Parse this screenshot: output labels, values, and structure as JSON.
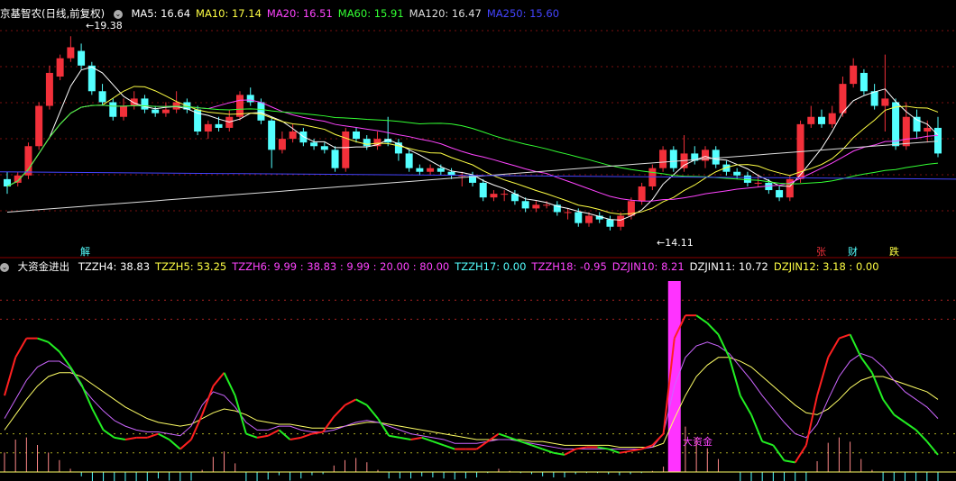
{
  "colors": {
    "up": "#f2303a",
    "down": "#54ffff",
    "ma5": "#ffffff",
    "ma10": "#ffff44",
    "ma20": "#ff44ff",
    "ma60": "#33ff33",
    "ma120": "#dddddd",
    "ma250": "#4444ff",
    "grid": "#7a1010"
  },
  "main_panel": {
    "title": "京基智农(日线,前复权)",
    "ma": [
      {
        "label": "MA5: 16.64",
        "color": "#ffffff"
      },
      {
        "label": "MA10: 17.14",
        "color": "#ffff44"
      },
      {
        "label": "MA20: 16.51",
        "color": "#ff44ff"
      },
      {
        "label": "MA60: 15.91",
        "color": "#33ff33"
      },
      {
        "label": "MA120: 16.47",
        "color": "#dddddd"
      },
      {
        "label": "MA250: 15.60",
        "color": "#4444ff"
      }
    ],
    "high_label": "19.38",
    "low_label": "14.11",
    "markers": [
      {
        "text": "解",
        "color": "#54ffff"
      },
      {
        "text": "张",
        "color": "#f2303a"
      },
      {
        "text": "财",
        "color": "#54ffff"
      },
      {
        "text": "跌",
        "color": "#ffff44"
      }
    ]
  },
  "indicator_panel": {
    "title": "大资金进出",
    "values": [
      {
        "label": "TZZH4: 38.83",
        "color": "#ffffff"
      },
      {
        "label": "TZZH5: 53.25",
        "color": "#ffff44"
      },
      {
        "label": "TZZH6: 9.99 : 38.83 : 9.99 : 20.00 : 80.00",
        "color": "#ff44ff"
      },
      {
        "label": "TZZH17: 0.00",
        "color": "#54ffff"
      },
      {
        "label": "TZZH18: -0.95",
        "color": "#ff44ff"
      },
      {
        "label": "DZJIN10: 8.21",
        "color": "#ff44ff"
      },
      {
        "label": "DZJIN11: 10.72",
        "color": "#ffffff"
      },
      {
        "label": "DZJIN12: 3.18 : 0.00",
        "color": "#ffff44"
      }
    ],
    "big_fund_label": "大资金"
  },
  "chart_data": {
    "type": "candlestick",
    "price_range": [
      13.8,
      19.8
    ],
    "candles": [
      [
        15.5,
        15.3,
        15.7,
        15.1
      ],
      [
        15.4,
        15.6,
        15.7,
        15.3
      ],
      [
        15.6,
        16.4,
        16.5,
        15.5
      ],
      [
        16.4,
        17.5,
        17.6,
        16.3
      ],
      [
        17.5,
        18.4,
        18.6,
        17.4
      ],
      [
        18.3,
        18.8,
        18.9,
        18.2
      ],
      [
        18.8,
        19.1,
        19.4,
        18.7
      ],
      [
        19.0,
        18.6,
        19.2,
        18.5
      ],
      [
        18.6,
        17.9,
        18.7,
        17.8
      ],
      [
        17.9,
        17.6,
        18.1,
        17.5
      ],
      [
        17.6,
        17.2,
        17.7,
        17.1
      ],
      [
        17.2,
        17.5,
        17.7,
        17.1
      ],
      [
        17.5,
        17.7,
        17.9,
        17.4
      ],
      [
        17.7,
        17.4,
        17.8,
        17.3
      ],
      [
        17.4,
        17.3,
        17.5,
        17.2
      ],
      [
        17.3,
        17.4,
        17.6,
        17.2
      ],
      [
        17.4,
        17.6,
        17.9,
        17.3
      ],
      [
        17.6,
        17.4,
        17.7,
        17.3
      ],
      [
        17.4,
        16.8,
        17.5,
        16.7
      ],
      [
        16.8,
        17.0,
        17.1,
        16.6
      ],
      [
        17.0,
        16.9,
        17.2,
        16.8
      ],
      [
        16.9,
        17.2,
        17.4,
        16.8
      ],
      [
        17.2,
        17.8,
        17.9,
        17.1
      ],
      [
        17.8,
        17.6,
        18.0,
        17.5
      ],
      [
        17.6,
        17.1,
        17.7,
        17.0
      ],
      [
        17.1,
        16.3,
        17.2,
        15.8
      ],
      [
        16.3,
        16.6,
        16.8,
        16.2
      ],
      [
        16.6,
        16.8,
        17.0,
        16.5
      ],
      [
        16.8,
        16.5,
        16.9,
        16.4
      ],
      [
        16.5,
        16.4,
        16.6,
        16.3
      ],
      [
        16.4,
        16.3,
        16.5,
        16.2
      ],
      [
        16.3,
        15.8,
        16.4,
        15.7
      ],
      [
        15.8,
        16.8,
        16.9,
        15.7
      ],
      [
        16.8,
        16.6,
        16.9,
        16.5
      ],
      [
        16.6,
        16.4,
        16.7,
        16.3
      ],
      [
        16.4,
        16.6,
        16.8,
        16.3
      ],
      [
        16.6,
        16.5,
        17.2,
        16.4
      ],
      [
        16.5,
        16.2,
        16.6,
        16.0
      ],
      [
        16.2,
        15.8,
        16.3,
        15.7
      ],
      [
        15.8,
        15.7,
        15.9,
        15.6
      ],
      [
        15.7,
        15.8,
        15.9,
        15.6
      ],
      [
        15.8,
        15.7,
        15.9,
        15.6
      ],
      [
        15.7,
        15.6,
        15.8,
        15.5
      ],
      [
        15.6,
        15.6,
        15.7,
        15.3
      ],
      [
        15.6,
        15.4,
        15.7,
        15.3
      ],
      [
        15.4,
        15.0,
        15.5,
        14.9
      ],
      [
        15.0,
        15.1,
        15.2,
        14.9
      ],
      [
        15.1,
        15.1,
        15.2,
        14.9
      ],
      [
        15.1,
        14.9,
        15.2,
        14.8
      ],
      [
        14.9,
        14.7,
        15.0,
        14.6
      ],
      [
        14.7,
        14.8,
        14.9,
        14.6
      ],
      [
        14.8,
        14.8,
        14.9,
        14.7
      ],
      [
        14.8,
        14.6,
        14.9,
        14.5
      ],
      [
        14.6,
        14.6,
        14.7,
        14.4
      ],
      [
        14.6,
        14.3,
        14.7,
        14.2
      ],
      [
        14.3,
        14.5,
        14.6,
        14.2
      ],
      [
        14.5,
        14.4,
        14.6,
        14.3
      ],
      [
        14.4,
        14.2,
        14.5,
        14.1
      ],
      [
        14.2,
        14.5,
        14.6,
        14.1
      ],
      [
        14.5,
        14.9,
        15.0,
        14.4
      ],
      [
        14.9,
        15.3,
        15.4,
        14.8
      ],
      [
        15.3,
        15.8,
        15.9,
        15.2
      ],
      [
        15.8,
        16.3,
        16.4,
        15.7
      ],
      [
        16.3,
        15.8,
        16.4,
        15.7
      ],
      [
        15.8,
        16.2,
        16.7,
        15.7
      ],
      [
        16.2,
        16.0,
        16.4,
        15.9
      ],
      [
        16.0,
        16.3,
        16.4,
        15.8
      ],
      [
        16.3,
        15.9,
        16.4,
        15.8
      ],
      [
        15.9,
        15.7,
        16.0,
        15.6
      ],
      [
        15.7,
        15.6,
        15.8,
        15.5
      ],
      [
        15.6,
        15.4,
        15.7,
        15.3
      ],
      [
        15.4,
        15.4,
        15.6,
        15.3
      ],
      [
        15.4,
        15.2,
        15.5,
        15.1
      ],
      [
        15.2,
        15.0,
        15.3,
        14.9
      ],
      [
        15.0,
        15.5,
        15.6,
        14.9
      ],
      [
        15.5,
        17.0,
        17.1,
        15.4
      ],
      [
        17.0,
        17.2,
        17.5,
        16.9
      ],
      [
        17.2,
        17.0,
        17.4,
        16.9
      ],
      [
        17.0,
        17.3,
        17.5,
        16.9
      ],
      [
        17.3,
        18.1,
        18.3,
        17.2
      ],
      [
        18.1,
        18.6,
        18.8,
        18.0
      ],
      [
        18.4,
        17.9,
        18.5,
        17.8
      ],
      [
        17.9,
        17.5,
        18.1,
        17.4
      ],
      [
        17.5,
        17.7,
        18.9,
        16.8
      ],
      [
        17.6,
        16.4,
        17.7,
        16.3
      ],
      [
        16.4,
        17.2,
        17.6,
        16.3
      ],
      [
        17.2,
        16.8,
        17.4,
        16.6
      ],
      [
        16.8,
        16.9,
        17.1,
        16.5
      ],
      [
        16.9,
        16.2,
        17.2,
        16.1
      ]
    ],
    "ma_values": {
      "MA5": 16.64,
      "MA10": 17.14,
      "MA20": 16.51,
      "MA60": 15.91,
      "MA120": 16.47,
      "MA250": 15.6
    },
    "indicator": {
      "red_green_line": [
        40,
        60,
        70,
        70,
        68,
        63,
        55,
        46,
        33,
        22,
        18,
        17,
        18,
        18,
        20,
        17,
        12,
        17,
        30,
        45,
        52,
        40,
        20,
        18,
        19,
        22,
        17,
        18,
        20,
        21,
        29,
        35,
        38,
        35,
        28,
        19,
        18,
        17,
        18,
        16,
        14,
        12,
        12,
        12,
        16,
        20,
        18,
        16,
        14,
        12,
        10,
        9,
        12,
        13,
        13,
        12,
        10,
        11,
        12,
        14,
        20,
        70,
        82,
        82,
        78,
        72,
        60,
        40,
        30,
        16,
        14,
        6,
        5,
        14,
        40,
        60,
        70,
        72,
        60,
        52,
        38,
        30,
        26,
        22,
        16,
        9
      ],
      "magenta_line": [
        28,
        38,
        48,
        55,
        58,
        58,
        54,
        45,
        38,
        32,
        27,
        24,
        22,
        21,
        21,
        20,
        19,
        24,
        35,
        42,
        40,
        34,
        26,
        22,
        22,
        24,
        24,
        22,
        21,
        21,
        22,
        24,
        26,
        27,
        26,
        24,
        22,
        20,
        19,
        18,
        17,
        15,
        15,
        15,
        16,
        17,
        17,
        16,
        15,
        14,
        13,
        12,
        12,
        12,
        12,
        12,
        12,
        12,
        12,
        13,
        20,
        45,
        60,
        66,
        68,
        66,
        62,
        55,
        48,
        40,
        33,
        26,
        20,
        18,
        25,
        38,
        50,
        58,
        62,
        60,
        55,
        48,
        42,
        38,
        34,
        28
      ],
      "yellow_line": [
        22,
        30,
        38,
        45,
        50,
        52,
        52,
        50,
        46,
        42,
        38,
        34,
        31,
        28,
        26,
        25,
        24,
        25,
        28,
        31,
        33,
        32,
        30,
        27,
        26,
        25,
        25,
        24,
        23,
        23,
        23,
        24,
        25,
        26,
        26,
        25,
        24,
        23,
        22,
        21,
        20,
        19,
        18,
        17,
        17,
        17,
        17,
        17,
        16,
        16,
        15,
        14,
        14,
        14,
        14,
        14,
        13,
        13,
        13,
        13,
        15,
        28,
        40,
        50,
        56,
        60,
        60,
        58,
        55,
        50,
        45,
        40,
        35,
        31,
        30,
        33,
        38,
        44,
        48,
        50,
        50,
        48,
        46,
        44,
        42,
        38
      ],
      "spike_index": 61,
      "spike_value": 100
    }
  }
}
